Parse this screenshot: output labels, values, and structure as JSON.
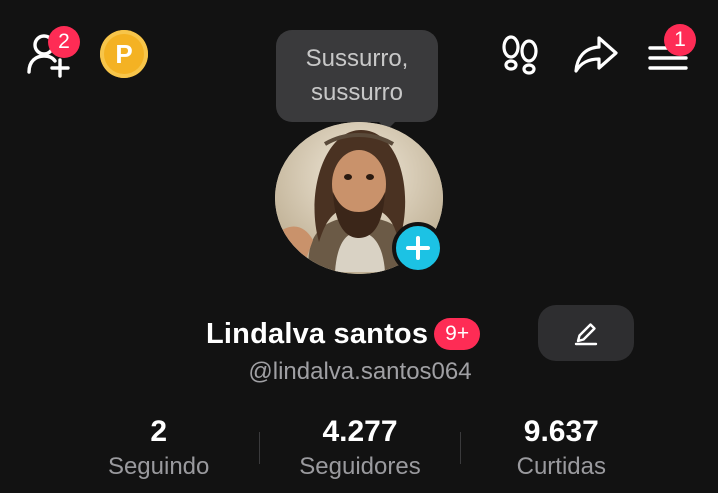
{
  "header": {
    "friend_requests_badge": "2",
    "coin_label": "P",
    "menu_badge": "1"
  },
  "tooltip": {
    "text": "Sussurro, sussurro"
  },
  "profile": {
    "display_name": "Lindalva santos",
    "name_badge": "9+",
    "username": "@lindalva.santos064"
  },
  "stats": [
    {
      "value": "2",
      "label": "Seguindo"
    },
    {
      "value": "4.277",
      "label": "Seguidores"
    },
    {
      "value": "9.637",
      "label": "Curtidas"
    }
  ],
  "colors": {
    "background": "#121212",
    "accent_red": "#fe2c55",
    "accent_cyan": "#1cc2e4",
    "coin_gold": "#f4b223"
  },
  "icons": {
    "add_friends": "person-plus-icon",
    "coins": "coin-icon",
    "profile_views": "footprints-icon",
    "share": "share-arrow-icon",
    "menu": "hamburger-menu-icon",
    "edit": "pencil-icon",
    "add_avatar": "plus-icon"
  }
}
